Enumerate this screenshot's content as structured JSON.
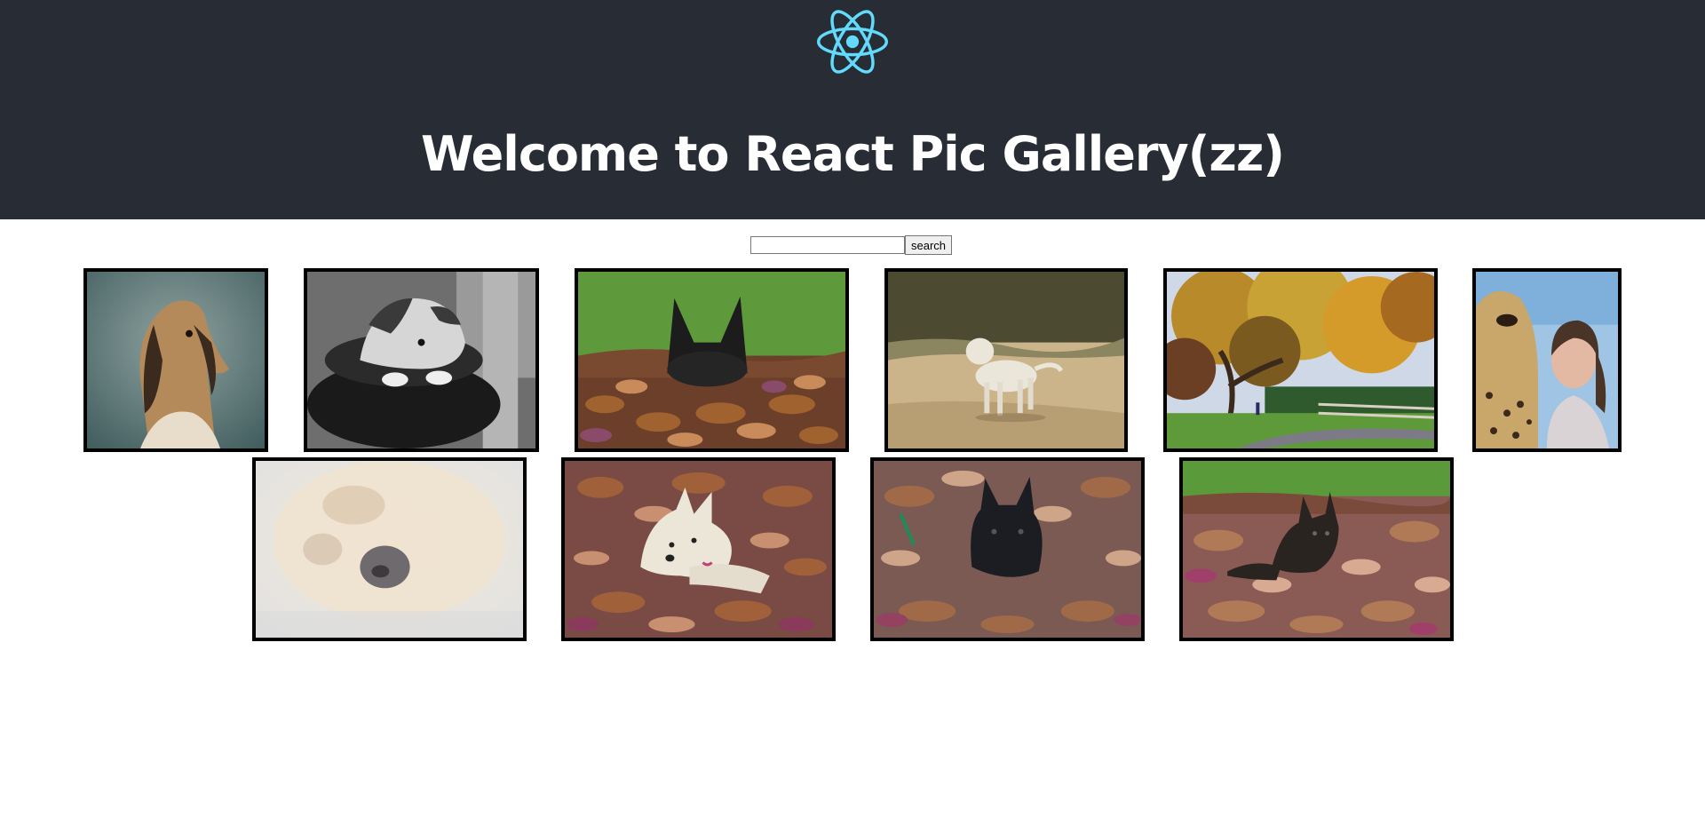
{
  "header": {
    "title": "Welcome to React Pic Gallery(zz)",
    "logo_icon": "react-atom-icon",
    "background_color": "#282c34",
    "logo_color": "#61dafb"
  },
  "search": {
    "value": "",
    "placeholder": "",
    "button_label": "search"
  },
  "gallery": {
    "images": [
      {
        "subject": "afghan-hound"
      },
      {
        "subject": "australian-shepherd-black-and-white"
      },
      {
        "subject": "dog-in-autumn-leaves"
      },
      {
        "subject": "white-dog-on-beach"
      },
      {
        "subject": "autumn-park"
      },
      {
        "subject": "cheetah-and-woman-selfie"
      },
      {
        "subject": "fluffy-white-dog-closeup"
      },
      {
        "subject": "westie-in-autumn-leaves"
      },
      {
        "subject": "scottie-in-autumn-leaves"
      },
      {
        "subject": "scottie-on-leaf-pile"
      }
    ]
  }
}
